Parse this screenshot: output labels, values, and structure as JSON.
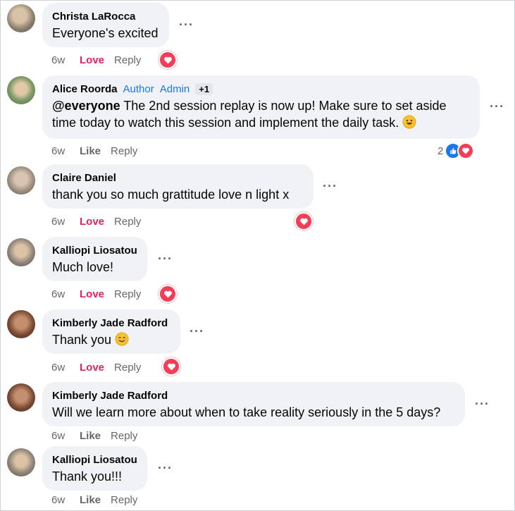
{
  "colors": {
    "love": "#e0245e",
    "badge": "#1877f2",
    "bubble": "#f0f2f5",
    "muted": "#65676b",
    "heart": "#f33e58"
  },
  "comments": [
    {
      "name": "Christa LaRocca",
      "text": "Everyone's excited",
      "time": "6w",
      "action": "Love",
      "reply": "Reply",
      "reaction": "love-icon"
    },
    {
      "name": "Alice Roorda",
      "badges": [
        "Author",
        "Admin"
      ],
      "badge_extra": "+1",
      "mention": "@everyone",
      "text_line1": " The 2nd session replay is now up! Make sure to set aside",
      "text_line2": "time today to watch this session and implement the daily task.",
      "emoji": "grinning-face-emoji",
      "time": "6w",
      "action": "Like",
      "reply": "Reply",
      "reaction_count": "2",
      "reactions": [
        "like-icon",
        "love-icon"
      ]
    },
    {
      "name": "Claire Daniel",
      "text": "thank you so much grattitude love n light x",
      "time": "6w",
      "action": "Love",
      "reply": "Reply",
      "reaction": "love-icon"
    },
    {
      "name": "Kalliopi Liosatou",
      "text": "Much love!",
      "time": "6w",
      "action": "Love",
      "reply": "Reply",
      "reaction": "love-icon"
    },
    {
      "name": "Kimberly Jade Radford",
      "text": "Thank you",
      "emoji": "smiling-face-emoji",
      "time": "6w",
      "action": "Love",
      "reply": "Reply",
      "reaction": "love-icon"
    },
    {
      "name": "Kimberly Jade Radford",
      "text": "Will we learn more about when to take reality seriously in the 5 days?",
      "time": "6w",
      "action": "Like",
      "reply": "Reply"
    },
    {
      "name": "Kalliopi Liosatou",
      "text": "Thank you!!!",
      "time": "6w",
      "action": "Like",
      "reply": "Reply"
    }
  ],
  "more_glyph": "···"
}
